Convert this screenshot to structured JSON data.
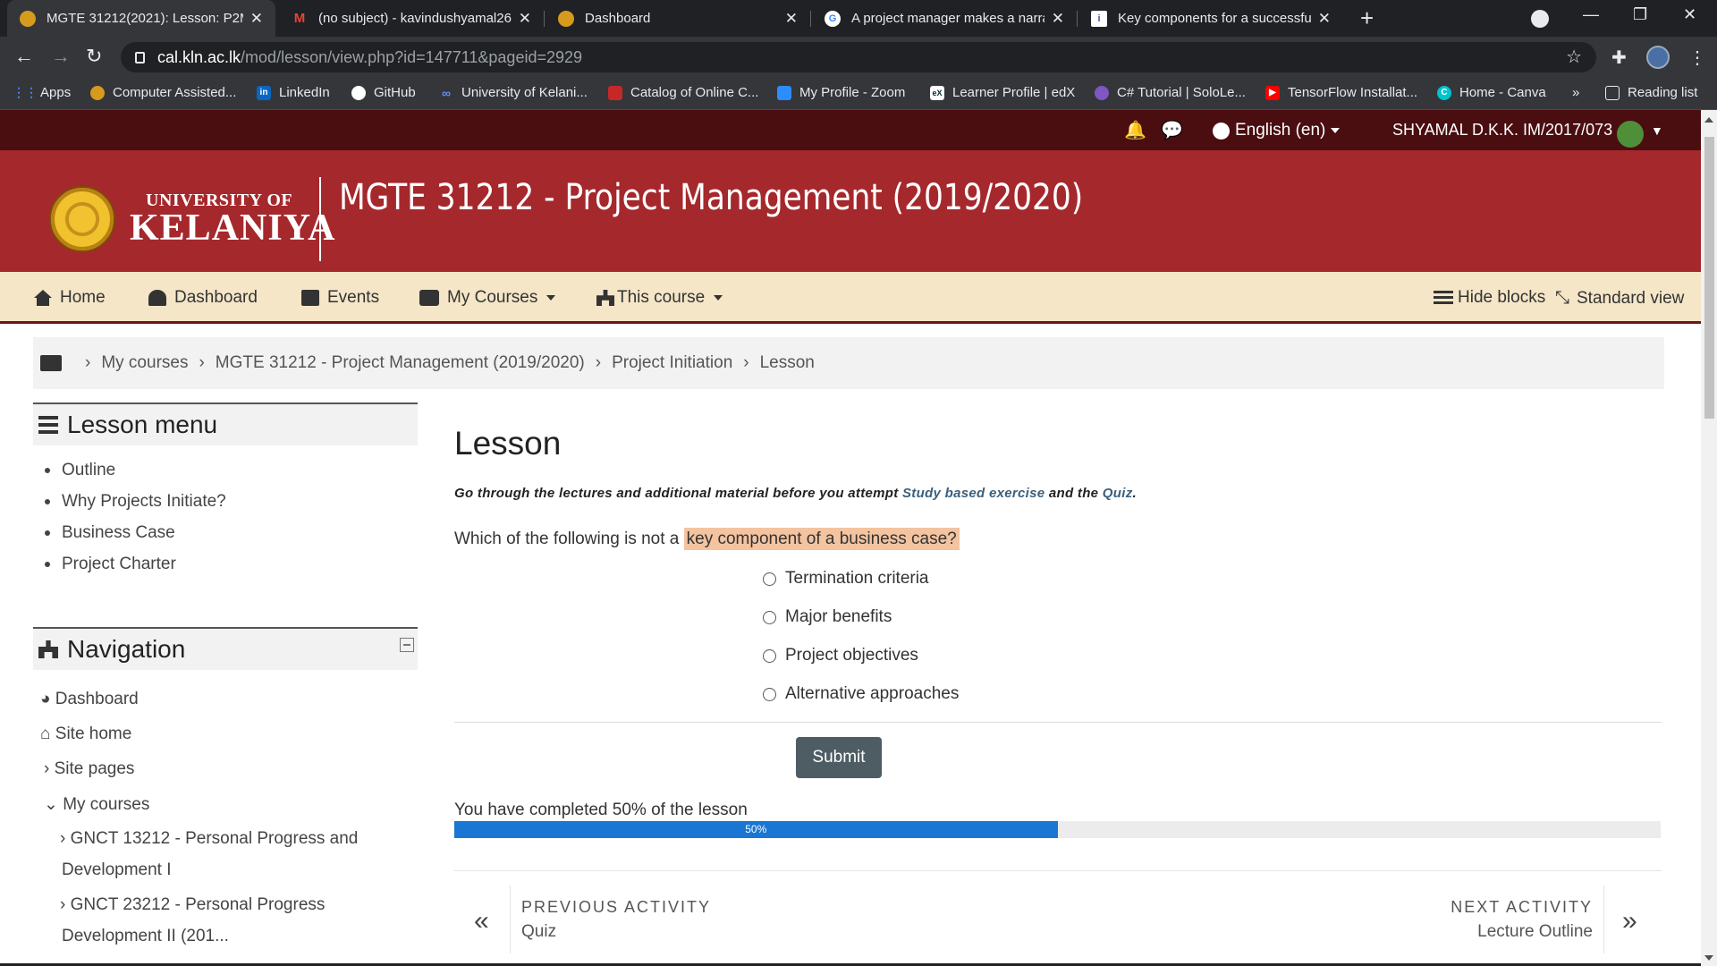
{
  "browser": {
    "tabs": [
      {
        "title": "MGTE 31212(2021): Lesson: P2M",
        "active": true
      },
      {
        "title": "(no subject) - kavindushyamal26"
      },
      {
        "title": "Dashboard"
      },
      {
        "title": "A project manager makes a narra"
      },
      {
        "title": "Key components for a successful"
      }
    ],
    "url_host": "cal.kln.ac.lk",
    "url_path": "/mod/lesson/view.php?id=147711&pageid=2929",
    "bookmarks": [
      "Apps",
      "Computer Assisted...",
      "LinkedIn",
      "GitHub",
      "University of Kelani...",
      "Catalog of Online C...",
      "My Profile - Zoom",
      "Learner Profile | edX",
      "C# Tutorial | SoloLe...",
      "TensorFlow Installat...",
      "Home - Canva"
    ],
    "bookmarks_overflow": "»",
    "reading_list": "Reading list"
  },
  "topbar": {
    "language": "English (en)",
    "user": "SHYAMAL D.K.K. IM/2017/073"
  },
  "header": {
    "logo_line1": "UNIVERSITY OF",
    "logo_line2": "KELANIYA",
    "course_title": "MGTE 31212 - Project Management (2019/2020)"
  },
  "nav": {
    "home": "Home",
    "dashboard": "Dashboard",
    "events": "Events",
    "my_courses": "My Courses",
    "this_course": "This course",
    "hide_blocks": "Hide blocks",
    "standard_view": "Standard view"
  },
  "breadcrumb": [
    "My courses",
    "MGTE 31212 - Project Management (2019/2020)",
    "Project Initiation",
    "Lesson"
  ],
  "lesson_menu": {
    "title": "Lesson menu",
    "items": [
      "Outline",
      "Why Projects Initiate?",
      "Business Case",
      "Project Charter"
    ]
  },
  "navigation": {
    "title": "Navigation",
    "items": [
      "Dashboard",
      "Site home",
      "Site pages",
      "My courses",
      "GNCT 13212 - Personal Progress and",
      "Development I",
      "GNCT 23212 - Personal Progress",
      "Development II (201..."
    ]
  },
  "main": {
    "title": "Lesson",
    "intro_a": "Go through the lectures and additional material before you attempt ",
    "intro_link1": "Study based exercise",
    "intro_b": " and the ",
    "intro_link2": "Quiz",
    "intro_c": ".",
    "question_a": "Which of the following is not a ",
    "question_highlight": "key component of a business case?",
    "options": [
      "Termination criteria",
      "Major benefits",
      "Project objectives",
      "Alternative approaches"
    ],
    "submit": "Submit",
    "progress_text": "You have completed 50% of the lesson",
    "progress_value": 50,
    "progress_label": "50%",
    "prev_label": "PREVIOUS ACTIVITY",
    "prev_name": "Quiz",
    "next_label": "NEXT ACTIVITY",
    "next_name": "Lecture Outline"
  }
}
